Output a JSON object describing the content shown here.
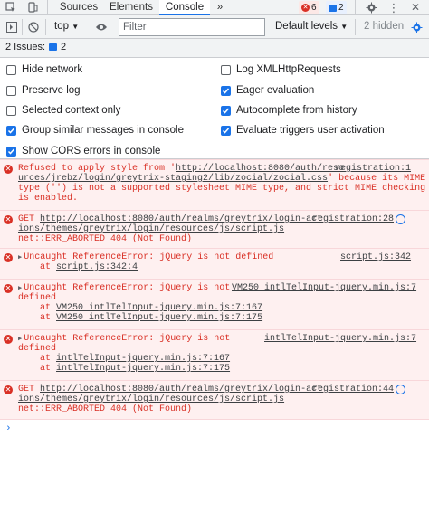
{
  "tabs": [
    "Sources",
    "Elements",
    "Console"
  ],
  "more_tabs": "»",
  "error_badge": "6",
  "issue_badge": "2",
  "toolbar": {
    "context": "top",
    "filter_placeholder": "Filter",
    "levels": "Default levels",
    "hidden": "2 hidden"
  },
  "issues_label": "2 Issues:",
  "issues_count": "2",
  "settings": [
    {
      "label": "Hide network",
      "checked": false
    },
    {
      "label": "Log XMLHttpRequests",
      "checked": false
    },
    {
      "label": "Preserve log",
      "checked": false
    },
    {
      "label": "Eager evaluation",
      "checked": true
    },
    {
      "label": "Selected context only",
      "checked": false
    },
    {
      "label": "Autocomplete from history",
      "checked": true
    },
    {
      "label": "Group similar messages in console",
      "checked": true
    },
    {
      "label": "Evaluate triggers user activation",
      "checked": true
    },
    {
      "label": "Show CORS errors in console",
      "checked": true
    }
  ],
  "messages": {
    "m1": {
      "line1a": "Refused to apply style from '",
      "line1_link": "http://localhost:8080/auth/reso",
      "src_line1": "registration:1",
      "line2": "urces/jrebz/login/greytrix-staging2/lib/zocial/zocial.css",
      "line2_end": "' because its MIME",
      "line3": "type ('') is not a supported stylesheet MIME type, and strict MIME checking",
      "line4": "is enabled."
    },
    "m2": {
      "prefix": "GET ",
      "url1": "http://localhost:8080/auth/realms/greytrix/login-act",
      "url2": "ions/themes/greytrix/login/resources/js/script.js",
      "status": "net::ERR_ABORTED 404 (Not Found)",
      "src": "registration:28"
    },
    "m3": {
      "text": "Uncaught ReferenceError: jQuery is not defined",
      "at": "at ",
      "at_link": "script.js:342:4",
      "src": "script.js:342"
    },
    "m4": {
      "text": "Uncaught ReferenceError: jQuery is not",
      "text2": "defined",
      "src": "VM250 intlTelInput-jquery.min.js:7",
      "at1": "VM250 intlTelInput-jquery.min.js:7:167",
      "at2": "VM250 intlTelInput-jquery.min.js:7:175"
    },
    "m5": {
      "text": "Uncaught ReferenceError: jQuery is not",
      "text2": "defined",
      "src": "intlTelInput-jquery.min.js:7",
      "at1": "intlTelInput-jquery.min.js:7:167",
      "at2": "intlTelInput-jquery.min.js:7:175"
    },
    "m6": {
      "prefix": "GET ",
      "url1": "http://localhost:8080/auth/realms/greytrix/login-act",
      "url2": "ions/themes/greytrix/login/resources/js/script.js",
      "status": "net::ERR_ABORTED 404 (Not Found)",
      "src": "registration:44"
    }
  },
  "prompt": "›",
  "colors": {
    "error_bg": "#fef0f0",
    "error_text": "#d93025",
    "accent": "#1a73e8"
  }
}
